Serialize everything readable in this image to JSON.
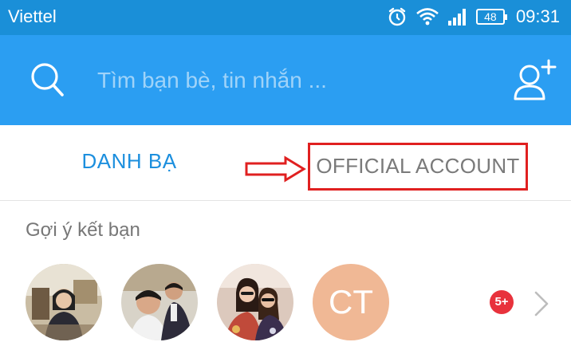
{
  "status_bar": {
    "carrier": "Viettel",
    "battery": "48",
    "time": "09:31",
    "icons": [
      "alarm-icon",
      "wifi-icon",
      "signal-icon",
      "battery-icon"
    ]
  },
  "search": {
    "placeholder": "Tìm bạn bè, tin nhắn ...",
    "icon": "search-icon",
    "add_friend_icon": "add-friend-icon"
  },
  "tabs": {
    "contacts": "DANH BẠ",
    "official": "OFFICIAL ACCOUNT"
  },
  "suggestions": {
    "title": "Gợi ý kết bạn",
    "avatars": [
      {
        "type": "photo"
      },
      {
        "type": "photo"
      },
      {
        "type": "photo"
      },
      {
        "type": "initials",
        "initials": "CT"
      }
    ],
    "badge": "5+"
  },
  "colors": {
    "status_bar": "#1a8fd8",
    "header": "#2b9ef2",
    "tab_active": "#1c8fde",
    "highlight": "#e02020",
    "badge": "#e8323c",
    "initials_avatar": "#f0b895"
  }
}
